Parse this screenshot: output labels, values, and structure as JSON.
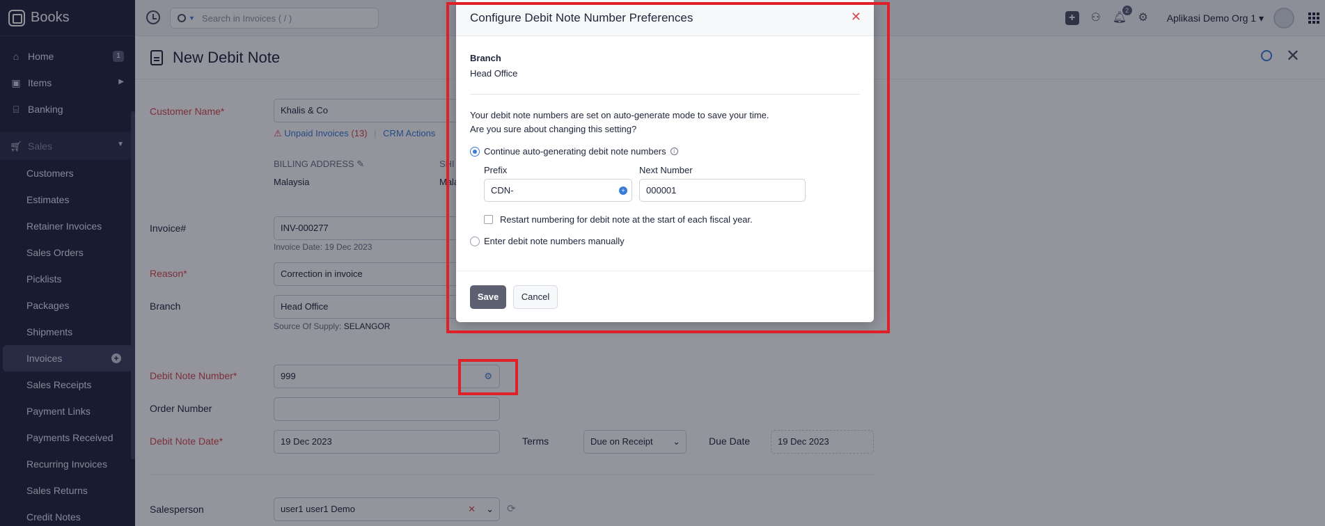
{
  "sidebar": {
    "brand": "Books",
    "items": [
      {
        "label": "Home",
        "icon": "home-icon",
        "badge": "1"
      },
      {
        "label": "Items",
        "icon": "items-icon"
      },
      {
        "label": "Banking",
        "icon": "bank-icon"
      }
    ],
    "section": "Sales",
    "sub_items": [
      "Customers",
      "Estimates",
      "Retainer Invoices",
      "Sales Orders",
      "Picklists",
      "Packages",
      "Shipments",
      "Invoices",
      "Sales Receipts",
      "Payment Links",
      "Payments Received",
      "Recurring Invoices",
      "Sales Returns",
      "Credit Notes"
    ],
    "active": "Invoices"
  },
  "topbar": {
    "search_placeholder": "Search in Invoices ( / )",
    "notifications": "2",
    "org": "Aplikasi Demo Org 1"
  },
  "page": {
    "title": "New Debit Note",
    "customer_label": "Customer Name*",
    "customer_value": "Khalis & Co",
    "unpaid_invoices": "Unpaid Invoices",
    "unpaid_count": "(13)",
    "crm_actions": "CRM Actions",
    "billing_label": "BILLING ADDRESS",
    "shipping_label_partial": "SHI",
    "billing_value": "Malaysia",
    "shipping_value_partial": "Mala",
    "invoice_label": "Invoice#",
    "invoice_value": "INV-000277",
    "invoice_date": "Invoice Date: 19 Dec 2023",
    "reason_label": "Reason*",
    "reason_value": "Correction in invoice",
    "branch_label": "Branch",
    "branch_value": "Head Office",
    "source_label": "Source Of Supply:",
    "source_value": "SELANGOR",
    "debit_number_label": "Debit Note Number*",
    "debit_number_value": "999",
    "order_label": "Order Number",
    "date_label": "Debit Note Date*",
    "date_value": "19 Dec 2023",
    "terms_label": "Terms",
    "terms_value": "Due on Receipt",
    "due_label": "Due Date",
    "due_value": "19 Dec 2023",
    "salesperson_label": "Salesperson",
    "salesperson_value": "user1 user1 Demo"
  },
  "modal": {
    "title": "Configure Debit Note Number Preferences",
    "branch_label": "Branch",
    "branch_value": "Head Office",
    "description": "Your debit note numbers are set on auto-generate mode to save your time. Are you sure about changing this setting?",
    "option_auto": "Continue auto-generating debit note numbers",
    "prefix_label": "Prefix",
    "prefix_value": "CDN-",
    "next_label": "Next Number",
    "next_value": "000001",
    "restart_label": "Restart numbering for debit note at the start of each fiscal year.",
    "option_manual": "Enter debit note numbers manually",
    "save": "Save",
    "cancel": "Cancel",
    "selected_option": "auto"
  },
  "colors": {
    "sidebar_bg": "#21263c",
    "accent": "#3a7bd5",
    "required": "#d6494b",
    "highlight": "#e02027"
  }
}
